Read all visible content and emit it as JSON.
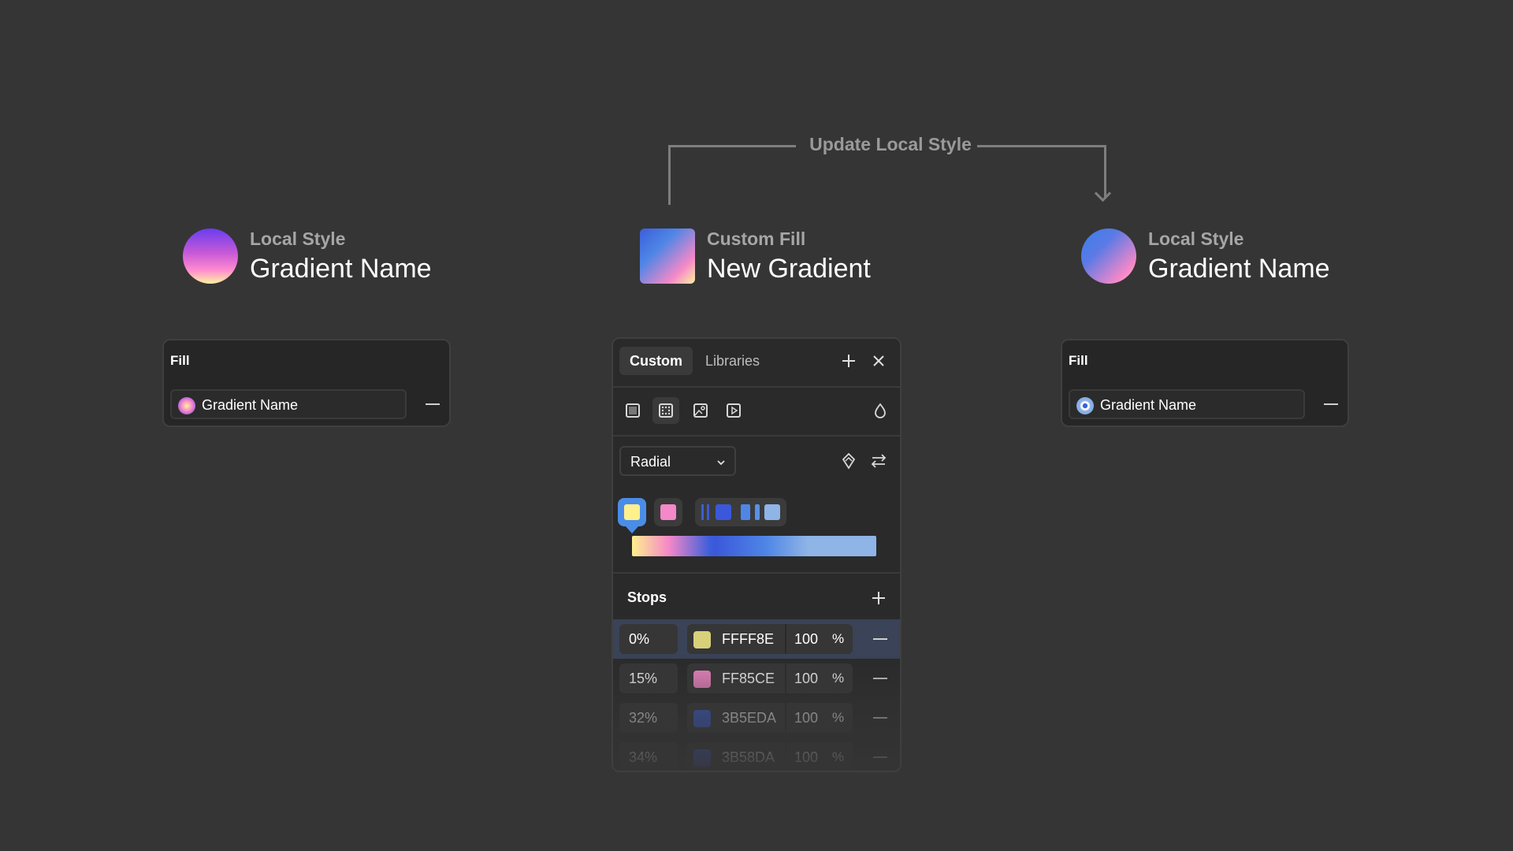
{
  "connector": {
    "label": "Update Local Style"
  },
  "left_header": {
    "kicker": "Local Style",
    "title": "Gradient Name"
  },
  "center_header": {
    "kicker": "Custom Fill",
    "title": "New Gradient"
  },
  "right_header": {
    "kicker": "Local Style",
    "title": "Gradient Name"
  },
  "left_fill": {
    "title": "Fill",
    "style_name": "Gradient Name"
  },
  "right_fill": {
    "title": "Fill",
    "style_name": "Gradient Name"
  },
  "picker": {
    "tabs": [
      {
        "label": "Custom",
        "active": true
      },
      {
        "label": "Libraries",
        "active": false
      }
    ],
    "fill_types": [
      "solid-fill-icon",
      "gradient-fill-icon",
      "image-fill-icon",
      "video-fill-icon"
    ],
    "gradient_type": {
      "value": "Radial"
    },
    "stops_title": "Stops",
    "stops": [
      {
        "position": "0%",
        "hex": "FFFF8E",
        "opacity": "100",
        "unit": "%",
        "color": "#fff08e"
      },
      {
        "position": "15%",
        "hex": "FF85CE",
        "opacity": "100",
        "unit": "%",
        "color": "#f588c8"
      },
      {
        "position": "32%",
        "hex": "3B5EDA",
        "opacity": "100",
        "unit": "%",
        "color": "#3b5eda"
      },
      {
        "position": "34%",
        "hex": "3B58DA",
        "opacity": "100",
        "unit": "%",
        "color": "#3b58da"
      }
    ]
  },
  "colors": {
    "background": "#353535",
    "panel": "#2a2a2a",
    "accent": "#4a8de8",
    "connector": "#7e7e7e"
  }
}
